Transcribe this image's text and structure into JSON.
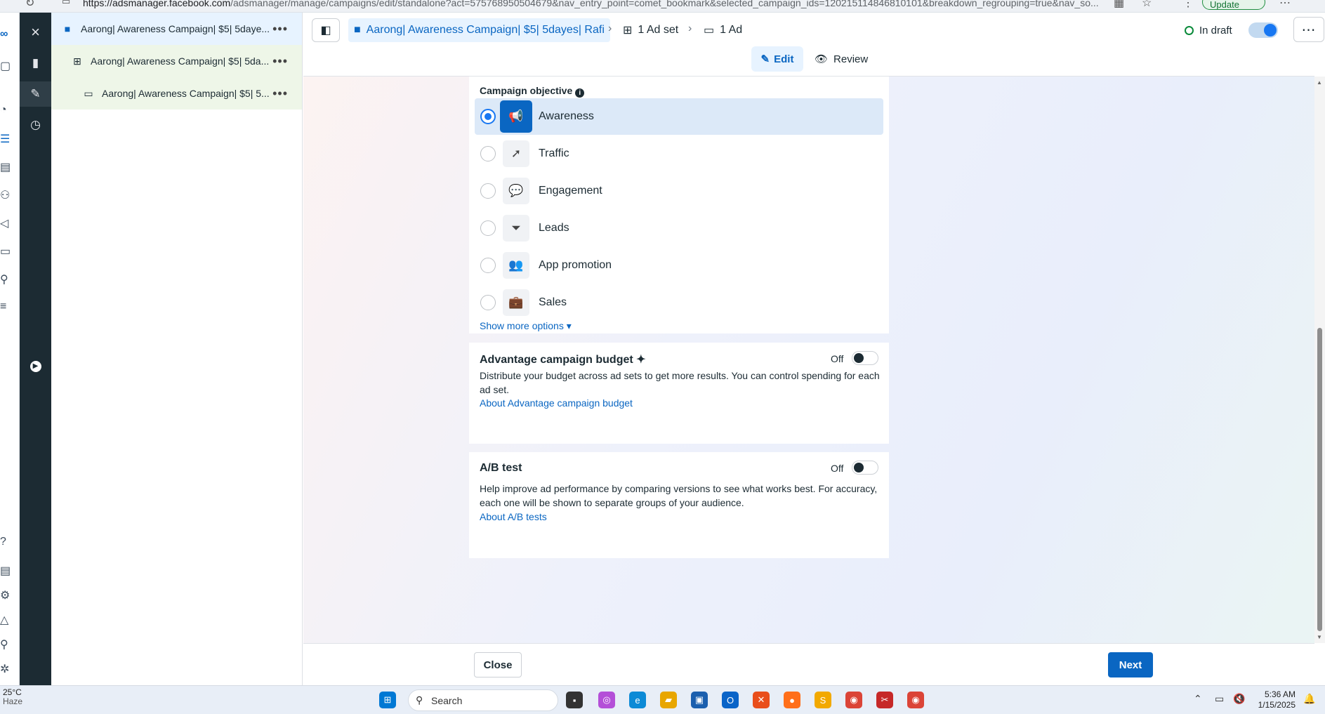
{
  "browser": {
    "url_domain": "https://adsmanager.facebook.com",
    "url_path": "/adsmanager/manage/campaigns/edit/standalone?act=575768950504679&nav_entry_point=comet_bookmark&selected_campaign_ids=120215114846810101&breakdown_regrouping=true&nav_so...",
    "update_label": "Update"
  },
  "tree": {
    "items": [
      {
        "label": "Aarong| Awareness Campaign| $5| 5daye...",
        "icon": "folder-icon"
      },
      {
        "label": "Aarong| Awareness Campaign| $5| 5da...",
        "icon": "adset-grid-icon"
      },
      {
        "label": "Aarong| Awareness Campaign| $5| 5...",
        "icon": "ad-icon"
      }
    ]
  },
  "header": {
    "campaign_crumb": "Aarong| Awareness Campaign| $5| 5dayes| Rafi",
    "adset_crumb": "1 Ad set",
    "ad_crumb": "1 Ad",
    "status": "In draft",
    "edit_label": "Edit",
    "review_label": "Review"
  },
  "objective": {
    "heading": "Campaign objective",
    "options": [
      {
        "label": "Awareness",
        "icon": "megaphone-icon",
        "selected": true
      },
      {
        "label": "Traffic",
        "icon": "cursor-icon",
        "selected": false
      },
      {
        "label": "Engagement",
        "icon": "chat-bubbles-icon",
        "selected": false
      },
      {
        "label": "Leads",
        "icon": "funnel-icon",
        "selected": false
      },
      {
        "label": "App promotion",
        "icon": "people-icon",
        "selected": false
      },
      {
        "label": "Sales",
        "icon": "briefcase-icon",
        "selected": false
      }
    ],
    "show_more": "Show more options"
  },
  "budget": {
    "title": "Advantage campaign budget",
    "toggle_label": "Off",
    "description": "Distribute your budget across ad sets to get more results. You can control spending for each ad set.",
    "link": "About Advantage campaign budget"
  },
  "abtest": {
    "title": "A/B test",
    "toggle_label": "Off",
    "description": "Help improve ad performance by comparing versions to see what works best. For accuracy, each one will be shown to separate groups of your audience.",
    "link": "About A/B tests"
  },
  "footer": {
    "close_label": "Close",
    "next_label": "Next"
  },
  "taskbar": {
    "temperature": "25°C",
    "weather": "Haze",
    "search_label": "Search",
    "time": "5:36 AM",
    "date": "1/15/2025"
  },
  "colors": {
    "accent": "#0a66c2",
    "sidebar_dark": "#1c2b33",
    "selected_bg": "#dce9f8"
  }
}
